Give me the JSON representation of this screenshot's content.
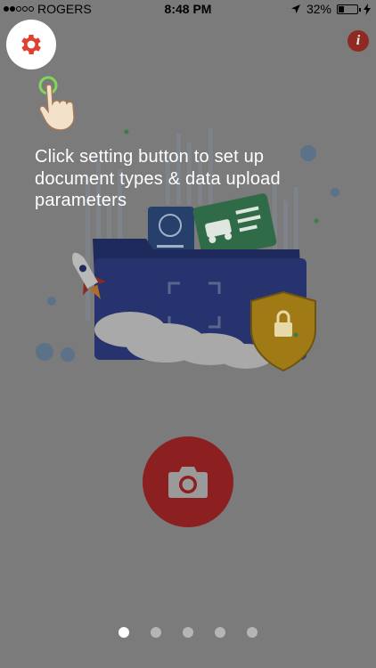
{
  "status_bar": {
    "carrier": "ROGERS",
    "time": "8:48 PM",
    "battery": "32%",
    "battery_level": 0.32,
    "signal_bars": 2
  },
  "hint": {
    "text": "Click setting button to set up document types & data upload parameters"
  },
  "icons": {
    "settings": "gear-icon",
    "info": "info-icon",
    "camera": "camera-icon",
    "pointer": "hand-pointer-icon"
  },
  "info_label": "i",
  "colors": {
    "overlay_bg": "#7b7b7b",
    "accent_red": "#e0412f",
    "camera_red": "#8c1f1f",
    "tap_ring": "#7ed957"
  },
  "pager": {
    "count": 5,
    "active_index": 0
  }
}
